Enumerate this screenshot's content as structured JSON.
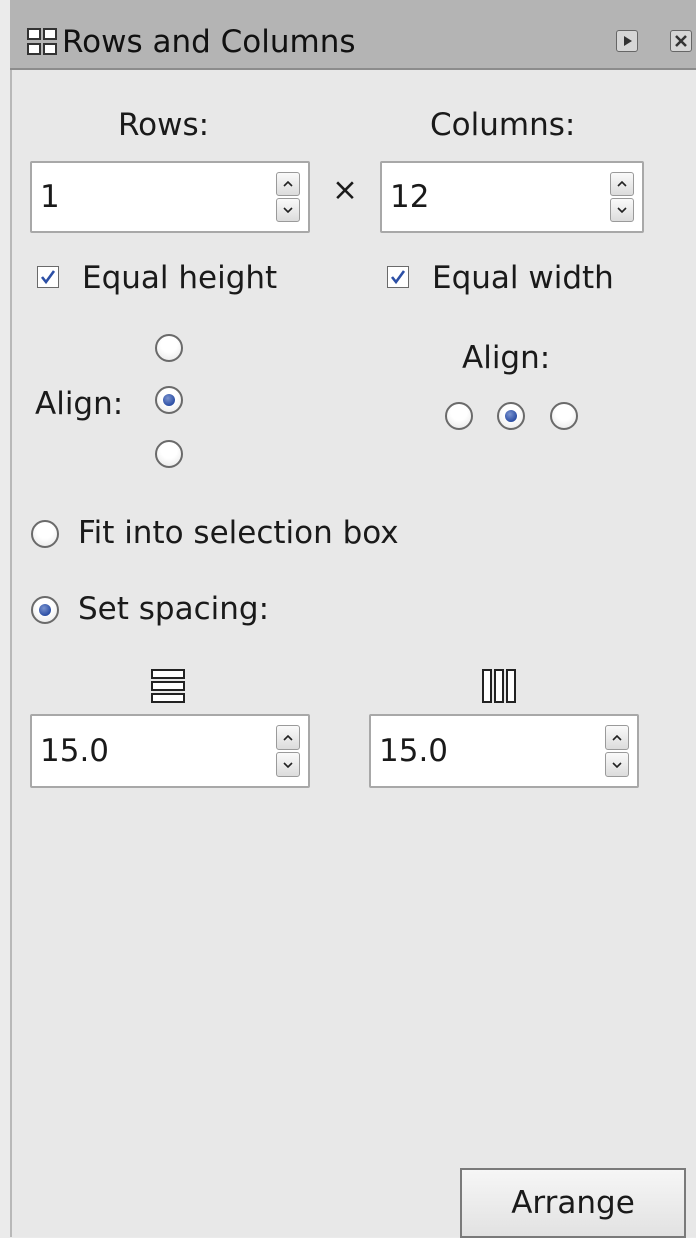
{
  "window": {
    "title": "Rows and Columns",
    "title_icon": "grid-icon",
    "buttons": [
      "dock-icon",
      "close-icon"
    ]
  },
  "rows": {
    "label": "Rows:",
    "value": "1"
  },
  "times_symbol": "×",
  "columns": {
    "label": "Columns:",
    "value": "12"
  },
  "equal_height": {
    "label": "Equal height",
    "checked": true
  },
  "equal_width": {
    "label": "Equal width",
    "checked": true
  },
  "row_align": {
    "label": "Align:",
    "options": [
      "top",
      "middle",
      "bottom"
    ],
    "selected": "middle"
  },
  "column_align": {
    "label": "Align:",
    "options": [
      "left",
      "center",
      "right"
    ],
    "selected": "center"
  },
  "fit_selection": {
    "label": "Fit into selection box",
    "selected": false
  },
  "set_spacing": {
    "label": "Set spacing:",
    "selected": true
  },
  "row_spacing": {
    "icon": "rows-spacing-icon",
    "value": "15.0"
  },
  "column_spacing": {
    "icon": "columns-spacing-icon",
    "value": "15.0"
  },
  "arrange_button": {
    "label": "Arrange"
  },
  "colors": {
    "titlebar": "#b4b4b4",
    "panel": "#e8e8e8",
    "accent": "#2c4fa5",
    "check": "#2c4fa5"
  }
}
